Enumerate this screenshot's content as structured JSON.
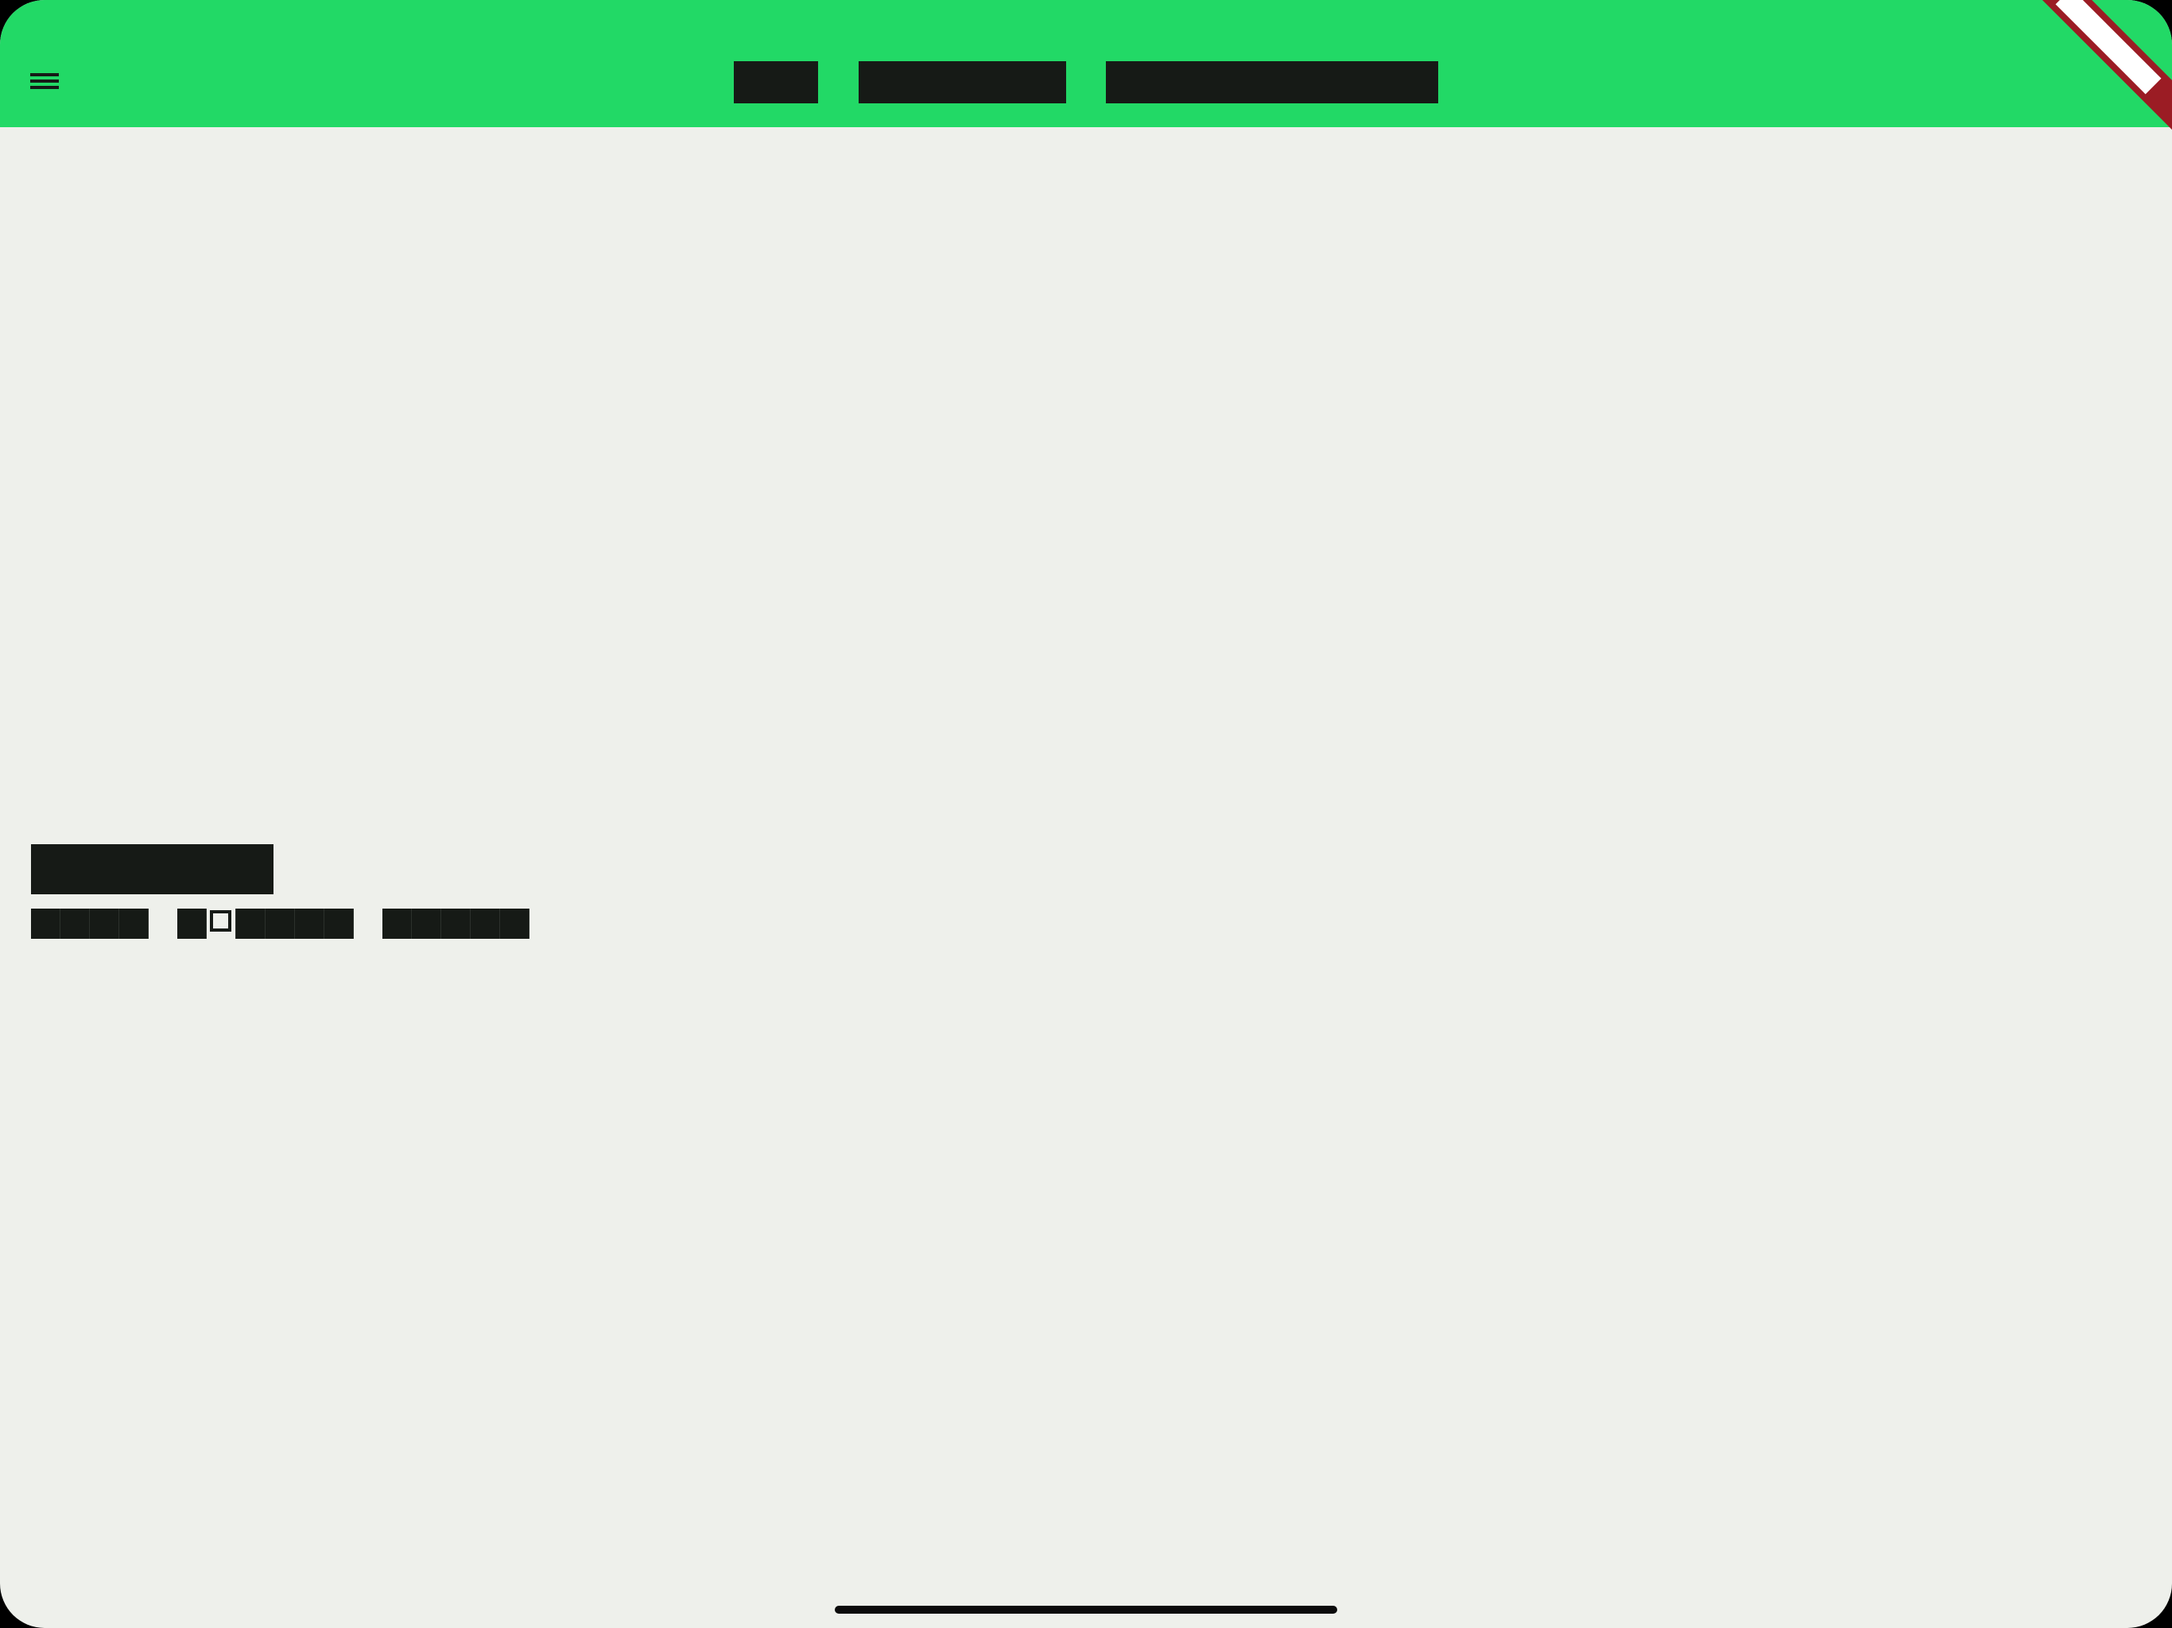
{
  "app_bar": {
    "color": "#22d966",
    "menu_icon": "menu-icon",
    "tabs": [
      {
        "label": ""
      },
      {
        "label": ""
      },
      {
        "label": ""
      }
    ]
  },
  "debug_banner": {
    "color": "#9b1c24",
    "label": ""
  },
  "content": {
    "heading": "",
    "subtitle_words": [
      [
        "",
        "",
        "",
        ""
      ],
      [
        "",
        "",
        "",
        "",
        "",
        ""
      ],
      [
        "",
        "",
        "",
        "",
        ""
      ]
    ]
  },
  "colors": {
    "background": "#eef0eb",
    "text_redacted": "#161a16"
  }
}
